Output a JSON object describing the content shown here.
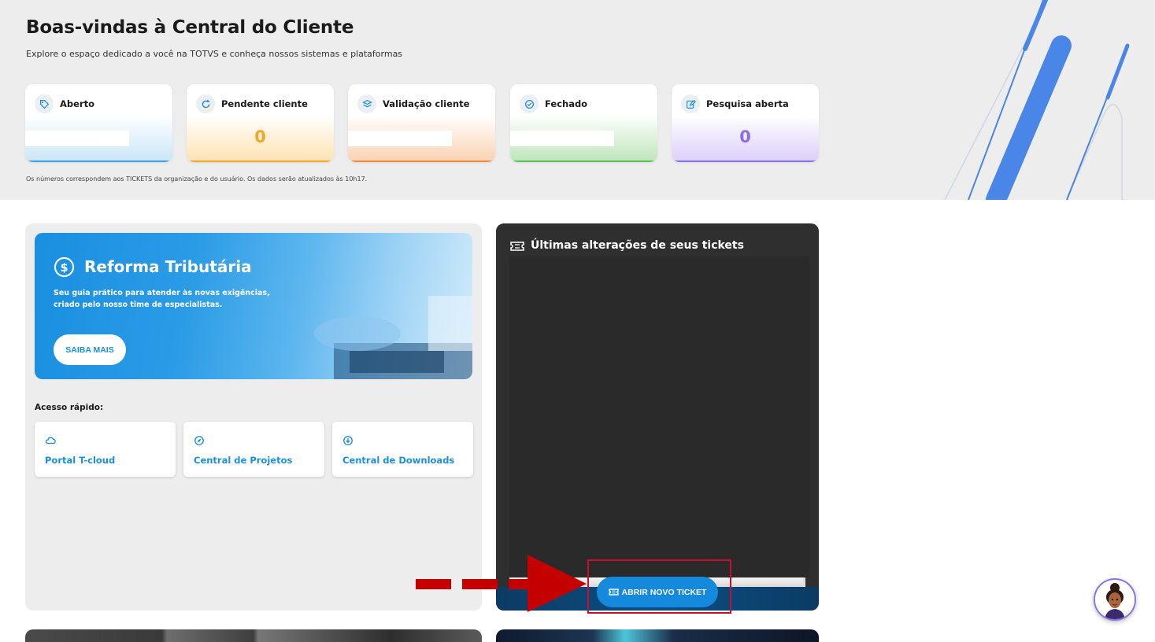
{
  "header": {
    "title": "Boas-vindas à Central do Cliente",
    "subtitle": "Explore o espaço dedicado a você na TOTVS e conheça nossos sistemas e plataformas",
    "note": "Os números correspondem aos TICKETS da organização e do usuário. Os dados serão atualizados às 10h17."
  },
  "stats": [
    {
      "label": "Aberto",
      "value": "",
      "icon": "tag-icon",
      "color": "#3aa0e0"
    },
    {
      "label": "Pendente cliente",
      "value": "0",
      "icon": "refresh-icon",
      "color": "#f6a623"
    },
    {
      "label": "Validação cliente",
      "value": "",
      "icon": "layers-icon",
      "color": "#f08a3c"
    },
    {
      "label": "Fechado",
      "value": "",
      "icon": "check-circle-icon",
      "color": "#5cbf5c"
    },
    {
      "label": "Pesquisa aberta",
      "value": "0",
      "icon": "edit-icon",
      "color": "#8b6cf0"
    }
  ],
  "banner": {
    "title": "Reforma Tributária",
    "description": "Seu guia prático para atender às novas exigências, criado pelo nosso time de especialistas.",
    "button": "SAIBA MAIS"
  },
  "quick_access": {
    "title": "Acesso rápido:",
    "items": [
      {
        "label": "Portal T-cloud",
        "icon": "cloud-icon"
      },
      {
        "label": "Central de Projetos",
        "icon": "compass-icon"
      },
      {
        "label": "Central de Downloads",
        "icon": "download-icon"
      }
    ]
  },
  "tickets": {
    "title": "Últimas alterações de seus tickets",
    "button": "ABRIR NOVO TICKET"
  },
  "colors": {
    "accent": "#1589db",
    "annotation": "#c8102e"
  }
}
